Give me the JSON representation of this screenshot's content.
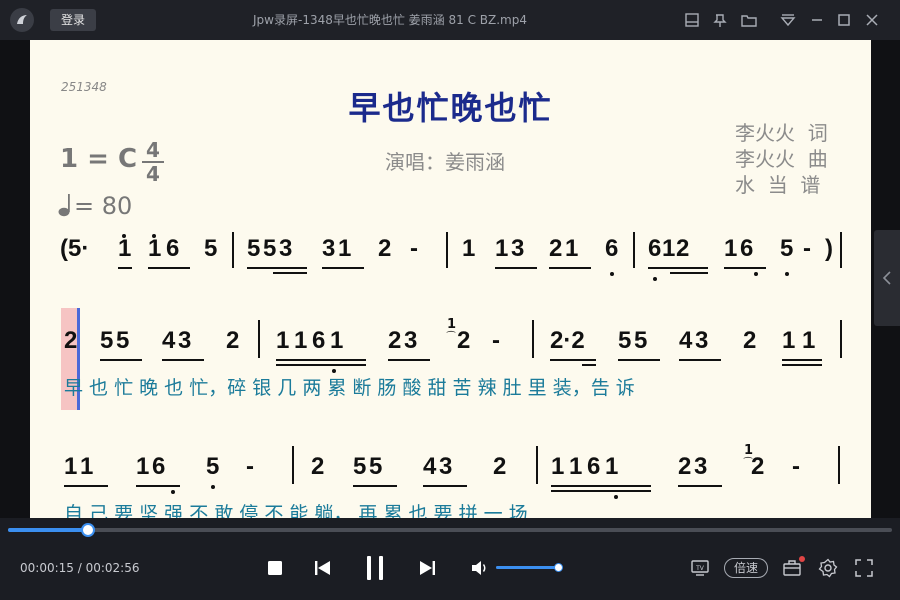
{
  "titlebar": {
    "login_label": "登录",
    "window_title": "Jpw录屏-1348早也忙晚也忙 姜雨涵 81 C BZ.mp4"
  },
  "sheet": {
    "score_id": "251348",
    "song_title": "早也忙晚也忙",
    "credits": [
      "李火火  词",
      "李火火  曲",
      "水  当  谱"
    ],
    "key": "1 = C",
    "time_sig_top": "4",
    "time_sig_bottom": "4",
    "singer": "演唱：姜雨涵",
    "tempo": "= 80",
    "line1": [
      "(5·",
      "1",
      "1 6",
      "5",
      "5 5 3",
      "3 1",
      "2",
      "-",
      "1",
      "1 3",
      "2 1",
      "6",
      "6 1 2",
      "1 6",
      "5",
      "-",
      ")"
    ],
    "line2": [
      "2",
      "5 5",
      "4 3",
      "2",
      "1 1 6 1",
      "2 3",
      "2",
      "-",
      "2·2",
      "5 5",
      "4 3",
      "2",
      "1 1"
    ],
    "line2_grace": "1",
    "lyrics2": "早 也 忙  晚 也 忙，碎 银 几 两  累 断  肠          酸 甜  苦 辣  肚 里  装，告 诉",
    "line3": [
      "1 1",
      "1 6",
      "5",
      "-",
      "2",
      "5 5",
      "4 3",
      "2",
      "1 1 6 1",
      "2 3",
      "2",
      "-"
    ],
    "line3_grace": "1",
    "lyrics3": "自 己  要 坚  强          不  敢 停  不 能  躺，  再 累 也 要  拼  一   场"
  },
  "player": {
    "progress": 0.091,
    "current_time": "00:00:15",
    "separator": " / ",
    "total_time": "00:02:56",
    "volume": 1.0,
    "speed_label": "倍速"
  },
  "colors": {
    "accent": "#3b8ff0",
    "title_blue": "#1b2a8c",
    "lyric_teal": "#1b7b9a",
    "sheet_bg": "#fdfaee"
  }
}
